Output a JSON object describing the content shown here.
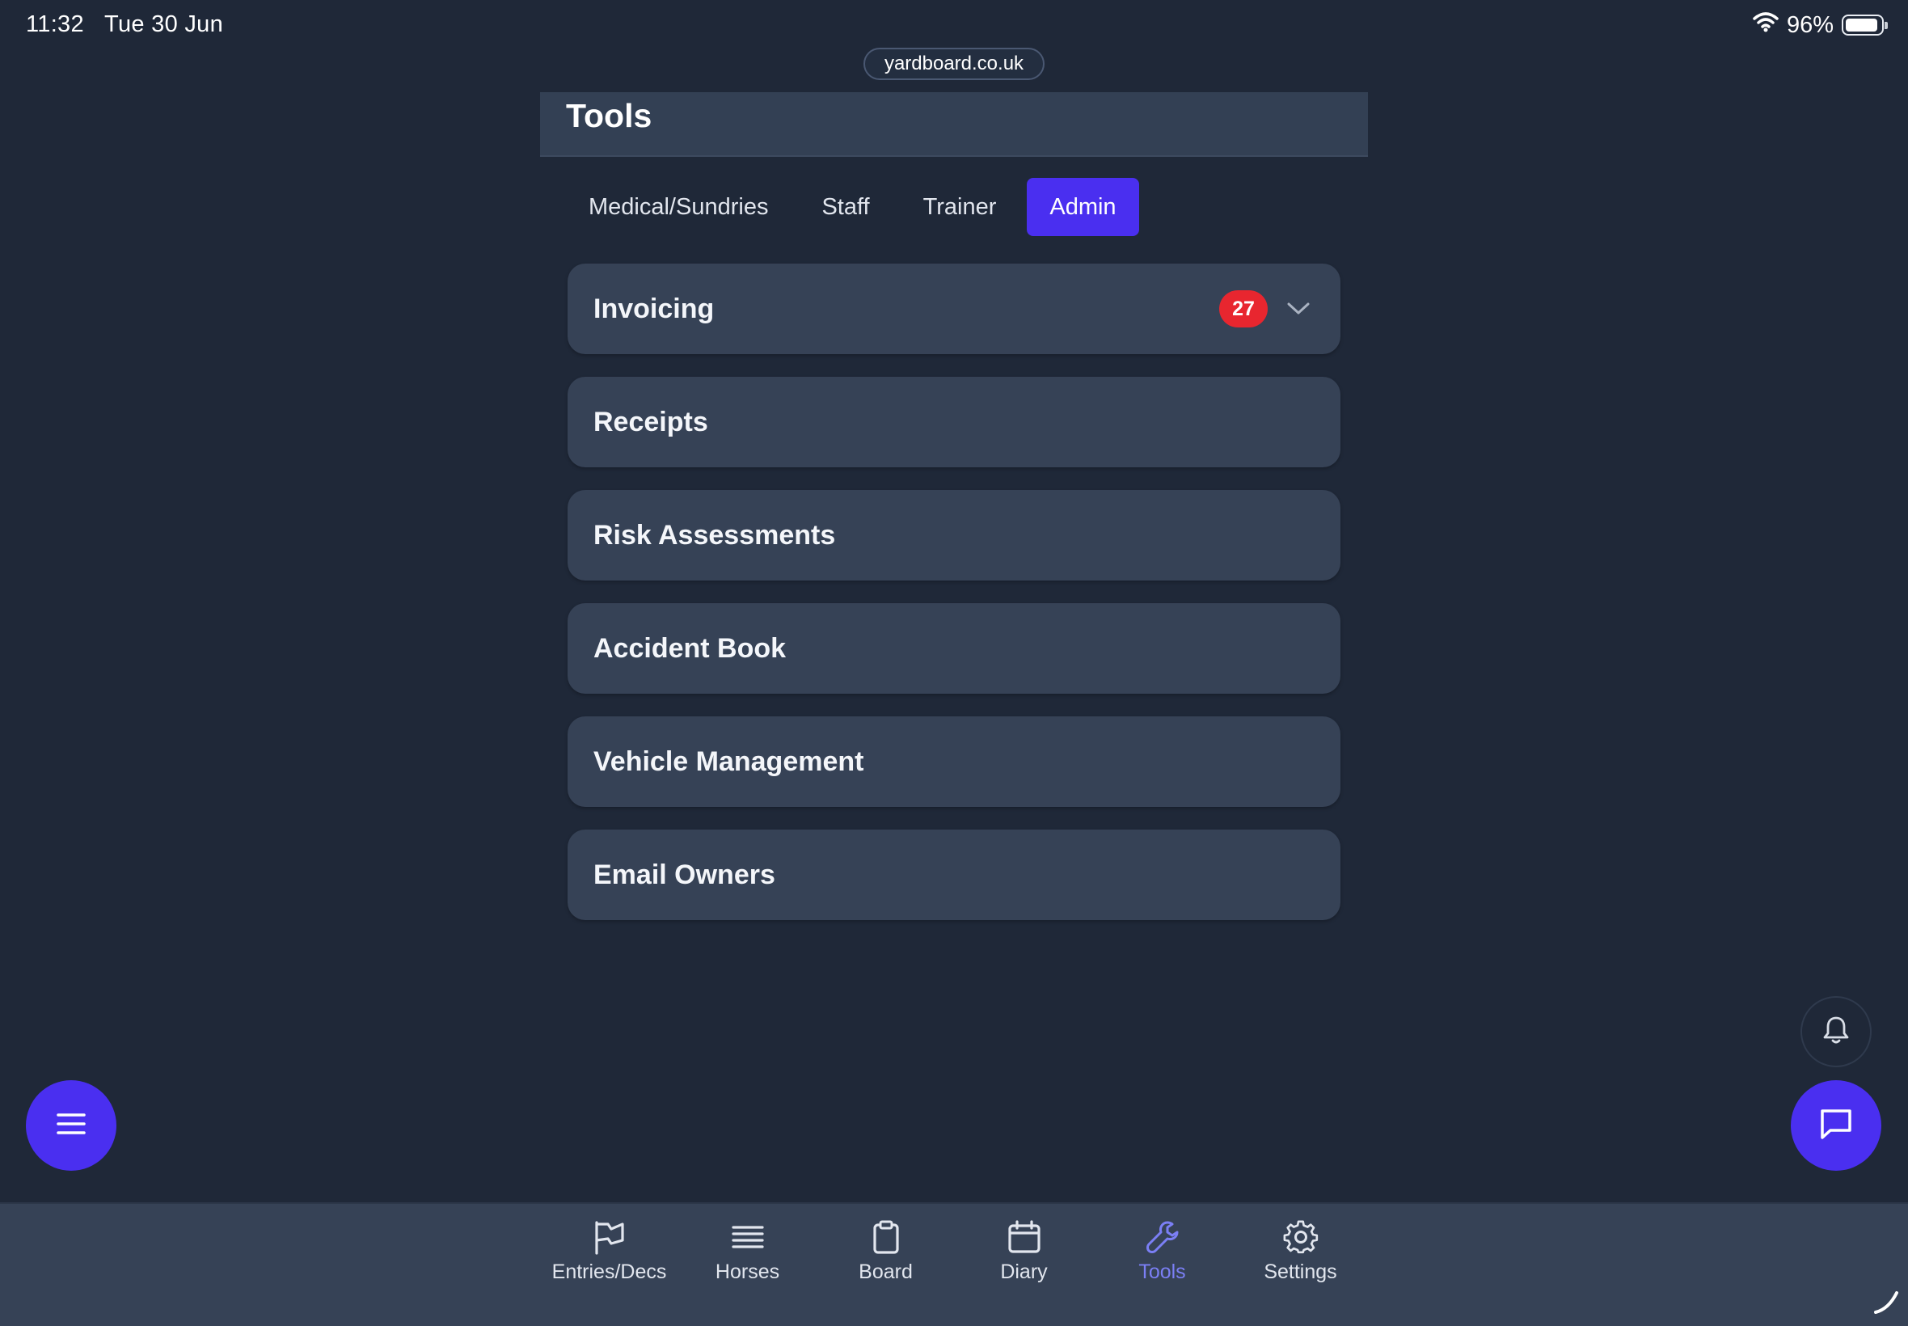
{
  "status_bar": {
    "time": "11:32",
    "date": "Tue 30 Jun",
    "battery": "96%",
    "battery_level": 0.96,
    "icons": [
      "wifi-icon",
      "battery-icon"
    ]
  },
  "browser": {
    "url": "yardboard.co.uk"
  },
  "header": {
    "title": "Tools"
  },
  "tabs": [
    {
      "label": "Medical/Sundries",
      "active": false
    },
    {
      "label": "Staff",
      "active": false
    },
    {
      "label": "Trainer",
      "active": false
    },
    {
      "label": "Admin",
      "active": true
    }
  ],
  "sections": [
    {
      "label": "Invoicing",
      "badge": "27",
      "expandable": true
    },
    {
      "label": "Receipts"
    },
    {
      "label": "Risk Assessments"
    },
    {
      "label": "Accident Book"
    },
    {
      "label": "Vehicle Management"
    },
    {
      "label": "Email Owners"
    }
  ],
  "fabs": {
    "menu_icon": "hamburger-icon",
    "chat_icon": "chat-bubble-icon",
    "bell_icon": "bell-icon"
  },
  "bottom_nav": [
    {
      "label": "Entries/Decs",
      "icon": "flag-icon",
      "active": false
    },
    {
      "label": "Horses",
      "icon": "list-icon",
      "active": false
    },
    {
      "label": "Board",
      "icon": "clipboard-icon",
      "active": false
    },
    {
      "label": "Diary",
      "icon": "calendar-icon",
      "active": false
    },
    {
      "label": "Tools",
      "icon": "wrench-icon",
      "active": true
    },
    {
      "label": "Settings",
      "icon": "gear-icon",
      "active": false
    }
  ],
  "colors": {
    "background": "#1f2838",
    "card": "#364256",
    "accent": "#4a2ff0",
    "badge": "#e8262f",
    "nav_active": "#7b7ff5"
  }
}
